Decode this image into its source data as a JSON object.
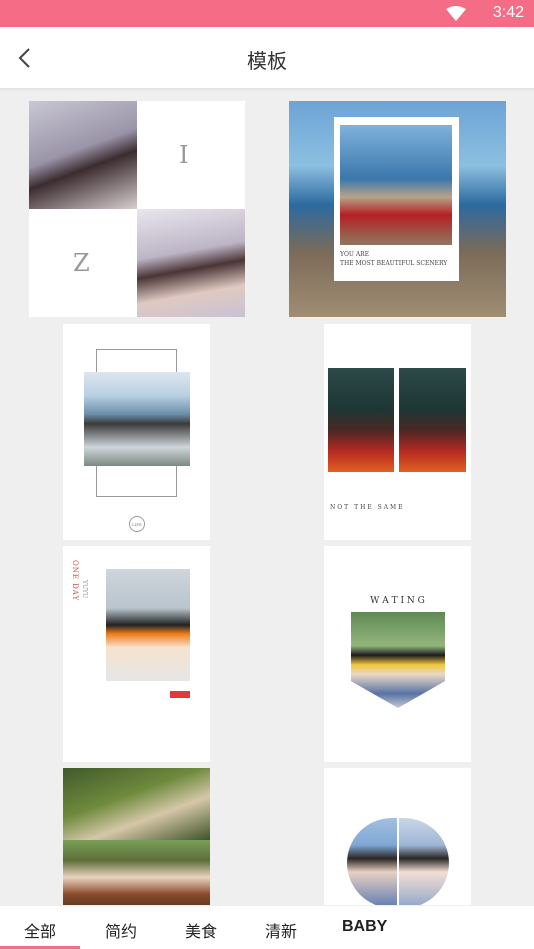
{
  "status_bar": {
    "time": "3:42"
  },
  "header": {
    "title": "模板"
  },
  "templates": {
    "t1": {
      "letter1": "I",
      "letter2": "Z"
    },
    "t2": {
      "line1": "YOU ARE",
      "line2": "THE MOST BEAUTIFUL SCENERY"
    },
    "t3": {
      "badge": "LIFE"
    },
    "t4": {
      "caption": "NOT THE SAME"
    },
    "t5": {
      "vertical1": "ONE DAY",
      "vertical2": "YUYU"
    },
    "t6": {
      "word": "W A T I N G"
    }
  },
  "tabs": [
    {
      "label": "全部",
      "selected": true
    },
    {
      "label": "简约"
    },
    {
      "label": "美食"
    },
    {
      "label": "清新"
    },
    {
      "label": "BABY"
    }
  ],
  "colors": {
    "accent": "#f46c86",
    "background": "#efefef"
  }
}
